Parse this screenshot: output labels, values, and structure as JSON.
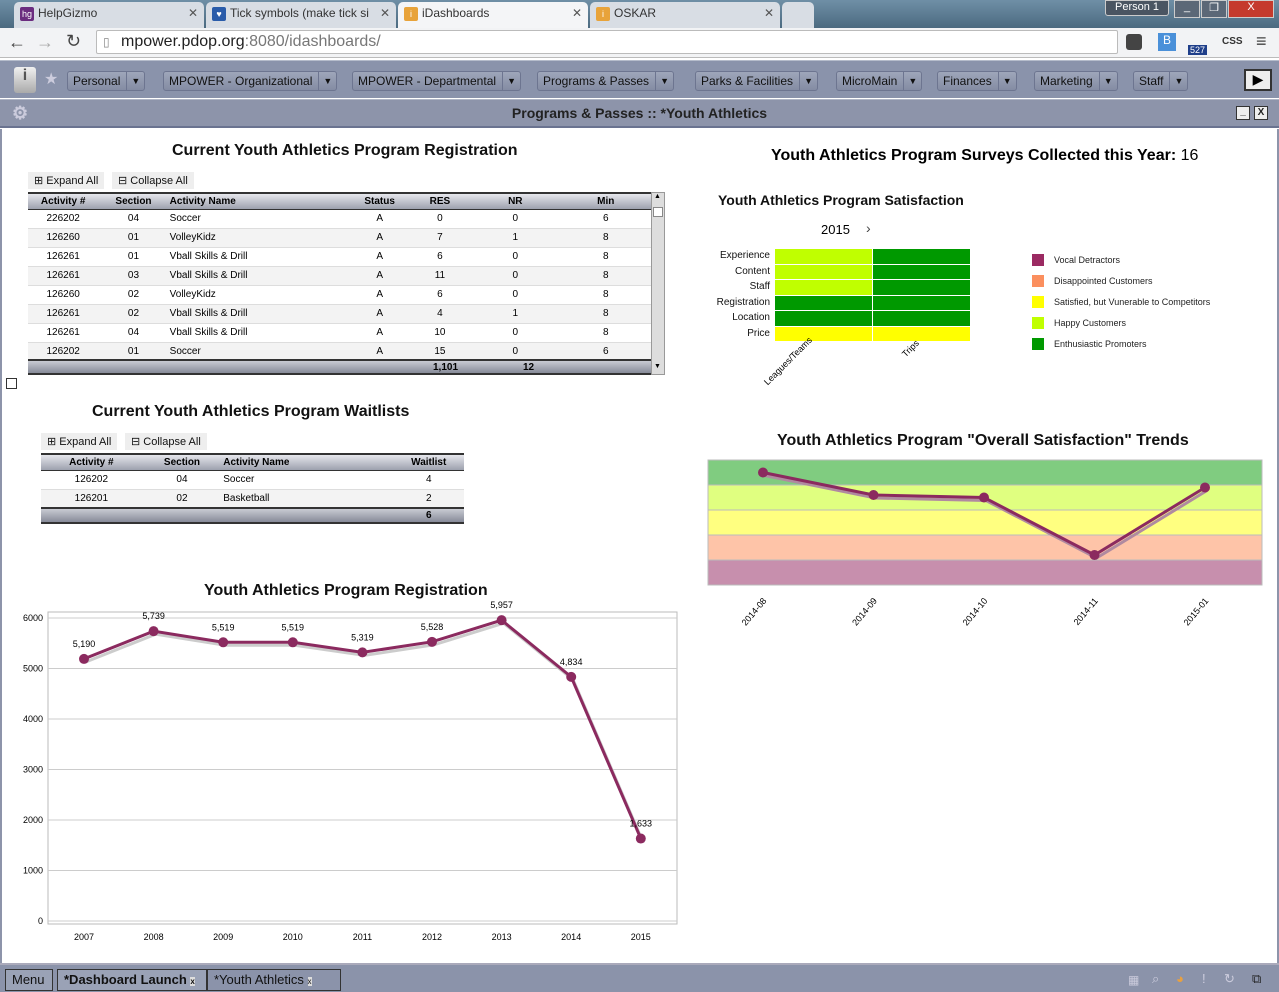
{
  "browser": {
    "tabs": [
      {
        "label": "HelpGizmo",
        "icon": "hg-icon",
        "color": "#6b2c7f"
      },
      {
        "label": "Tick symbols (make tick si",
        "icon": "heart-icon",
        "color": "#2a5caa"
      },
      {
        "label": "iDashboards",
        "icon": "idashboards-icon",
        "color": "#e8a33a",
        "active": true
      },
      {
        "label": "OSKAR",
        "icon": "idashboards-icon",
        "color": "#e8a33a"
      }
    ],
    "profile": "Person 1",
    "url_host": "mpower.pdop.org",
    "url_rest": ":8080/idashboards/",
    "ext_badge": "527",
    "ext_css": "CSS"
  },
  "nav": {
    "items": [
      "Personal",
      "MPOWER - Organizational",
      "MPOWER - Departmental",
      "Programs & Passes",
      "Parks & Facilities",
      "MicroMain",
      "Finances",
      "Marketing",
      "Staff"
    ]
  },
  "titlebar": {
    "title": "Programs & Passes :: *Youth Athletics"
  },
  "registration_table": {
    "title": "Current Youth Athletics Program Registration",
    "expand": "Expand All",
    "collapse": "Collapse All",
    "columns": [
      "Activity #",
      "Section",
      "Activity Name",
      "Status",
      "RES",
      "NR",
      "Min"
    ],
    "rows": [
      [
        "226202",
        "04",
        "Soccer",
        "A",
        "0",
        "0",
        "6"
      ],
      [
        "126260",
        "01",
        "VolleyKidz",
        "A",
        "7",
        "1",
        "8"
      ],
      [
        "126261",
        "01",
        "Vball Skills & Drill",
        "A",
        "6",
        "0",
        "8"
      ],
      [
        "126261",
        "03",
        "Vball Skills & Drill",
        "A",
        "11",
        "0",
        "8"
      ],
      [
        "126260",
        "02",
        "VolleyKidz",
        "A",
        "6",
        "0",
        "8"
      ],
      [
        "126261",
        "02",
        "Vball Skills & Drill",
        "A",
        "4",
        "1",
        "8"
      ],
      [
        "126261",
        "04",
        "Vball Skills & Drill",
        "A",
        "10",
        "0",
        "8"
      ],
      [
        "126202",
        "01",
        "Soccer",
        "A",
        "15",
        "0",
        "6"
      ]
    ],
    "totals": {
      "RES": "1,101",
      "NR": "12"
    }
  },
  "waitlist_table": {
    "title": "Current Youth Athletics Program Waitlists",
    "expand": "Expand All",
    "collapse": "Collapse All",
    "columns": [
      "Activity #",
      "Section",
      "Activity Name",
      "Waitlist"
    ],
    "rows": [
      [
        "126202",
        "04",
        "Soccer",
        "4"
      ],
      [
        "126201",
        "02",
        "Basketball",
        "2"
      ]
    ],
    "total": "6"
  },
  "surveys": {
    "label": "Youth Athletics Program Surveys Collected this Year:",
    "value": "16"
  },
  "chart_data": [
    {
      "type": "line",
      "title": "Youth Athletics Program Registration",
      "categories": [
        "2007",
        "2008",
        "2009",
        "2010",
        "2011",
        "2012",
        "2013",
        "2014",
        "2015"
      ],
      "values": [
        5190,
        5739,
        5519,
        5519,
        5319,
        5528,
        5957,
        4834,
        1633
      ],
      "labels": [
        "5,190",
        "5,739",
        "5,519",
        "5,519",
        "5,319",
        "5,528",
        "5,957",
        "4,834",
        "1,633"
      ],
      "yticks": [
        "0",
        "1000",
        "2000",
        "3000",
        "4000",
        "5000",
        "6000"
      ],
      "ylim": [
        0,
        6000
      ],
      "grid": true,
      "color": "#8b2a5f"
    },
    {
      "type": "heatmap",
      "title": "Youth Athletics Program Satisfaction",
      "period": "2015",
      "rows": [
        "Experience",
        "Content",
        "Staff",
        "Registration",
        "Location",
        "Price"
      ],
      "columns": [
        "Leagues/Teams",
        "Trips"
      ],
      "values": [
        [
          "Happy Customers",
          "Enthusiastic Promoters"
        ],
        [
          "Happy Customers",
          "Enthusiastic Promoters"
        ],
        [
          "Happy Customers",
          "Enthusiastic Promoters"
        ],
        [
          "Enthusiastic Promoters",
          "Enthusiastic Promoters"
        ],
        [
          "Enthusiastic Promoters",
          "Enthusiastic Promoters"
        ],
        [
          "Satisfied, but Vunerable to Competitors",
          "Satisfied, but Vunerable to Competitors"
        ]
      ],
      "legend": [
        {
          "label": "Vocal Detractors",
          "color": "#9b2a62"
        },
        {
          "label": "Disappointed Customers",
          "color": "#fb8f5e"
        },
        {
          "label": "Satisfied, but Vunerable to Competitors",
          "color": "#ffff00"
        },
        {
          "label": "Happy Customers",
          "color": "#c0ff00"
        },
        {
          "label": "Enthusiastic Promoters",
          "color": "#009900"
        }
      ],
      "legend_position": "right"
    },
    {
      "type": "line",
      "title": "Youth Athletics Program \"Overall Satisfaction\" Trends",
      "categories": [
        "2014-08",
        "2014-09",
        "2014-10",
        "2014-11",
        "2015-01"
      ],
      "values": [
        4.5,
        3.6,
        3.5,
        1.2,
        3.9
      ],
      "ylim": [
        0,
        5
      ],
      "bands": [
        "#c78fad",
        "#fec4a8",
        "#ffff80",
        "#e0ff80",
        "#80cc80"
      ],
      "color": "#8b2a5f"
    }
  ],
  "taskbar": {
    "menu": "Menu",
    "tabs": [
      "*Dashboard Launch",
      "*Youth Athletics"
    ]
  }
}
